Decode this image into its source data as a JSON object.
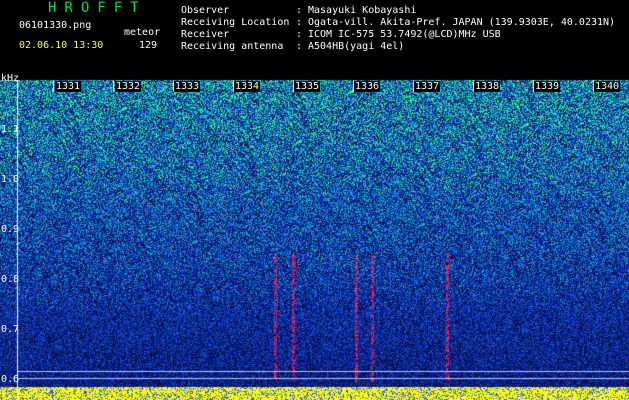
{
  "header": {
    "app_title": "HROFFT",
    "filename": "06101330.png",
    "mode": "meteor",
    "datetime": "02.06.10 13:30",
    "count": "129"
  },
  "info": [
    {
      "label": "Observer",
      "value": "Masayuki Kobayashi"
    },
    {
      "label": "Receiving Location",
      "value": "Ogata-vill. Akita-Pref. JAPAN (139.9303E, 40.0231N)"
    },
    {
      "label": "Receiver",
      "value": "ICOM IC-575 53.7492(@LCD)MHz USB"
    },
    {
      "label": "Receiving antenna",
      "value": "A504HB(yagi 4el)"
    }
  ],
  "axis": {
    "unit": "kHz",
    "ticks": [
      "1.1",
      "1.0",
      "0.9",
      "0.8",
      "0.7",
      "0.6"
    ],
    "times": [
      "1331",
      "1332",
      "1333",
      "1334",
      "1335",
      "1336",
      "1337",
      "1338",
      "1339",
      "1340"
    ]
  },
  "colors": {
    "background": "#000000",
    "title": "#00e040",
    "date": "#ffff40",
    "spectrum_low": "#0a2a8a",
    "spectrum_high": "#00ff80",
    "echo": "#ff2060",
    "baseline": "#ffff00"
  }
}
